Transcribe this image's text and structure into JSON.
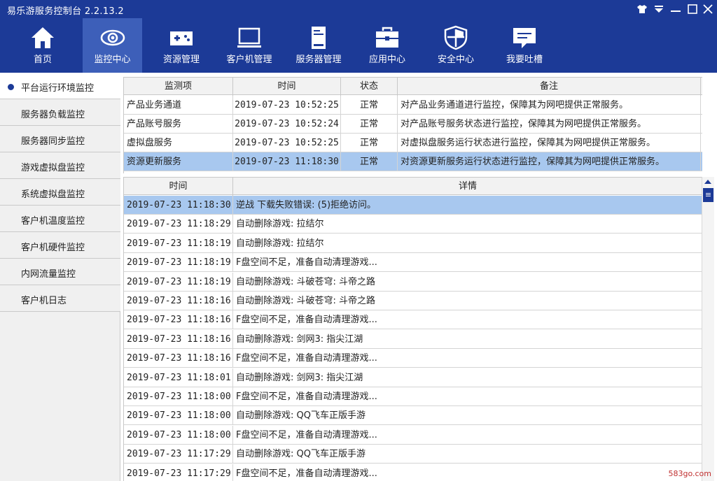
{
  "window": {
    "title": "易乐游服务控制台 2.2.13.2",
    "controls": [
      "shirt-icon",
      "dropdown-icon",
      "minimize-icon",
      "maximize-icon",
      "close-icon"
    ]
  },
  "toolbar": {
    "items": [
      {
        "label": "首页",
        "icon": "home-icon",
        "active": false
      },
      {
        "label": "监控中心",
        "icon": "eye-icon",
        "active": true
      },
      {
        "label": "资源管理",
        "icon": "gamepad-icon",
        "active": false
      },
      {
        "label": "客户机管理",
        "icon": "monitor-icon",
        "active": false
      },
      {
        "label": "服务器管理",
        "icon": "server-icon",
        "active": false
      },
      {
        "label": "应用中心",
        "icon": "toolbox-icon",
        "active": false
      },
      {
        "label": "安全中心",
        "icon": "shield-icon",
        "active": false
      },
      {
        "label": "我要吐槽",
        "icon": "feedback-icon",
        "active": false
      }
    ]
  },
  "sidebar": {
    "items": [
      {
        "label": "平台运行环境监控",
        "active": true
      },
      {
        "label": "服务器负载监控",
        "active": false
      },
      {
        "label": "服务器同步监控",
        "active": false
      },
      {
        "label": "游戏虚拟盘监控",
        "active": false
      },
      {
        "label": "系统虚拟盘监控",
        "active": false
      },
      {
        "label": "客户机温度监控",
        "active": false
      },
      {
        "label": "客户机硬件监控",
        "active": false
      },
      {
        "label": "内网流量监控",
        "active": false
      },
      {
        "label": "客户机日志",
        "active": false
      }
    ]
  },
  "monitor_table": {
    "columns": [
      "监测项",
      "时间",
      "状态",
      "备注"
    ],
    "rows": [
      {
        "item": "产品业务通道",
        "time": "2019-07-23 10:52:25",
        "status": "正常",
        "note": "对产品业务通道进行监控，保障其为网吧提供正常服务。",
        "selected": false
      },
      {
        "item": "产品账号服务",
        "time": "2019-07-23 10:52:24",
        "status": "正常",
        "note": "对产品账号服务状态进行监控，保障其为网吧提供正常服务。",
        "selected": false
      },
      {
        "item": "虚拟盘服务",
        "time": "2019-07-23 10:52:25",
        "status": "正常",
        "note": "对虚拟盘服务运行状态进行监控，保障其为网吧提供正常服务。",
        "selected": false
      },
      {
        "item": "资源更新服务",
        "time": "2019-07-23 11:18:30",
        "status": "正常",
        "note": "对资源更新服务运行状态进行监控，保障其为网吧提供正常服务。",
        "selected": true
      }
    ]
  },
  "log_table": {
    "columns": [
      "时间",
      "详情"
    ],
    "rows": [
      {
        "time": "2019-07-23 11:18:30",
        "detail": "逆战 下载失败错误: (5)拒绝访问。",
        "selected": true
      },
      {
        "time": "2019-07-23 11:18:29",
        "detail": "自动删除游戏: 拉结尔",
        "selected": false
      },
      {
        "time": "2019-07-23 11:18:19",
        "detail": "自动删除游戏: 拉结尔",
        "selected": false
      },
      {
        "time": "2019-07-23 11:18:19",
        "detail": "F盘空间不足，准备自动清理游戏...",
        "selected": false
      },
      {
        "time": "2019-07-23 11:18:19",
        "detail": "自动删除游戏: 斗破苍穹: 斗帝之路",
        "selected": false
      },
      {
        "time": "2019-07-23 11:18:16",
        "detail": "自动删除游戏: 斗破苍穹: 斗帝之路",
        "selected": false
      },
      {
        "time": "2019-07-23 11:18:16",
        "detail": "F盘空间不足，准备自动清理游戏...",
        "selected": false
      },
      {
        "time": "2019-07-23 11:18:16",
        "detail": "自动删除游戏: 剑网3: 指尖江湖",
        "selected": false
      },
      {
        "time": "2019-07-23 11:18:16",
        "detail": "F盘空间不足，准备自动清理游戏...",
        "selected": false
      },
      {
        "time": "2019-07-23 11:18:01",
        "detail": "自动删除游戏: 剑网3: 指尖江湖",
        "selected": false
      },
      {
        "time": "2019-07-23 11:18:00",
        "detail": "F盘空间不足，准备自动清理游戏...",
        "selected": false
      },
      {
        "time": "2019-07-23 11:18:00",
        "detail": "自动删除游戏: QQ飞车正版手游",
        "selected": false
      },
      {
        "time": "2019-07-23 11:18:00",
        "detail": "F盘空间不足，准备自动清理游戏...",
        "selected": false
      },
      {
        "time": "2019-07-23 11:17:29",
        "detail": "自动删除游戏: QQ飞车正版手游",
        "selected": false
      },
      {
        "time": "2019-07-23 11:17:29",
        "detail": "F盘空间不足，准备自动清理游戏...",
        "selected": false
      }
    ]
  },
  "scroll_thumb_glyph": "≡",
  "watermark": "583go.com",
  "colors": {
    "brand": "#1c3a97",
    "active_tab": "#3d5fb9",
    "selection": "#a8c8ef"
  }
}
